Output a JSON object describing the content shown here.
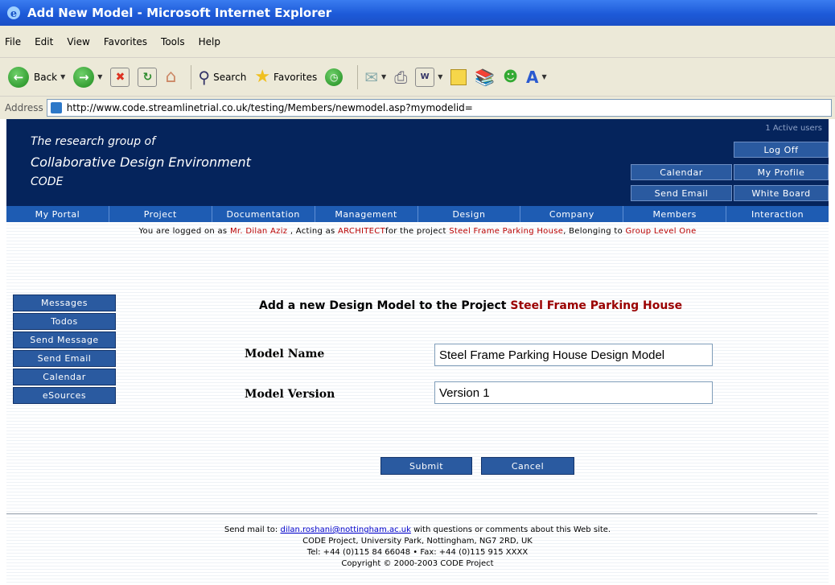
{
  "window": {
    "title": "Add New Model - Microsoft Internet Explorer"
  },
  "menu": [
    "File",
    "Edit",
    "View",
    "Favorites",
    "Tools",
    "Help"
  ],
  "toolbar": {
    "back": "Back",
    "search": "Search",
    "favorites": "Favorites"
  },
  "address": {
    "label": "Address",
    "url": "http://www.code.streamlinetrial.co.uk/testing/Members/newmodel.asp?mymodelid="
  },
  "header": {
    "line1": "The research group of",
    "line2": "Collaborative Design Environment",
    "line3": "CODE",
    "active_users": "1 Active users",
    "log_off": "Log Off",
    "calendar": "Calendar",
    "my_profile": "My Profile",
    "send_email": "Send Email",
    "white_board": "White Board"
  },
  "nav": [
    "My Portal",
    "Project",
    "Documentation",
    "Management",
    "Design",
    "Company",
    "Members",
    "Interaction"
  ],
  "status": {
    "prefix": "You are logged on as ",
    "user": "Mr. Dilan Aziz",
    "acting": " , Acting as ",
    "role": "ARCHITECT",
    "for_project": "for the project ",
    "project": "Steel Frame Parking House",
    "belonging": ", Belonging to ",
    "group": "Group Level One"
  },
  "sidebar": [
    "Messages",
    "Todos",
    "Send Message",
    "Send Email",
    "Calendar",
    "eSources"
  ],
  "form": {
    "title_prefix": "Add a new Design Model to the Project ",
    "title_project": "Steel Frame Parking House",
    "model_name_label": "Model Name",
    "model_name_value": "Steel Frame Parking House Design Model",
    "model_version_label": "Model Version",
    "model_version_value": "Version 1",
    "submit": "Submit",
    "cancel": "Cancel"
  },
  "footer": {
    "send_mail_prefix": "Send mail to: ",
    "email": "dilan.roshani@nottingham.ac.uk",
    "send_mail_suffix": " with questions or comments about this Web site.",
    "address": "CODE Project, University Park, Nottingham, NG7 2RD, UK",
    "tel": "Tel: +44 (0)115 84 66048 • Fax: +44 (0)115 915 XXXX",
    "copyright": "Copyright © 2000-2003 CODE Project"
  }
}
